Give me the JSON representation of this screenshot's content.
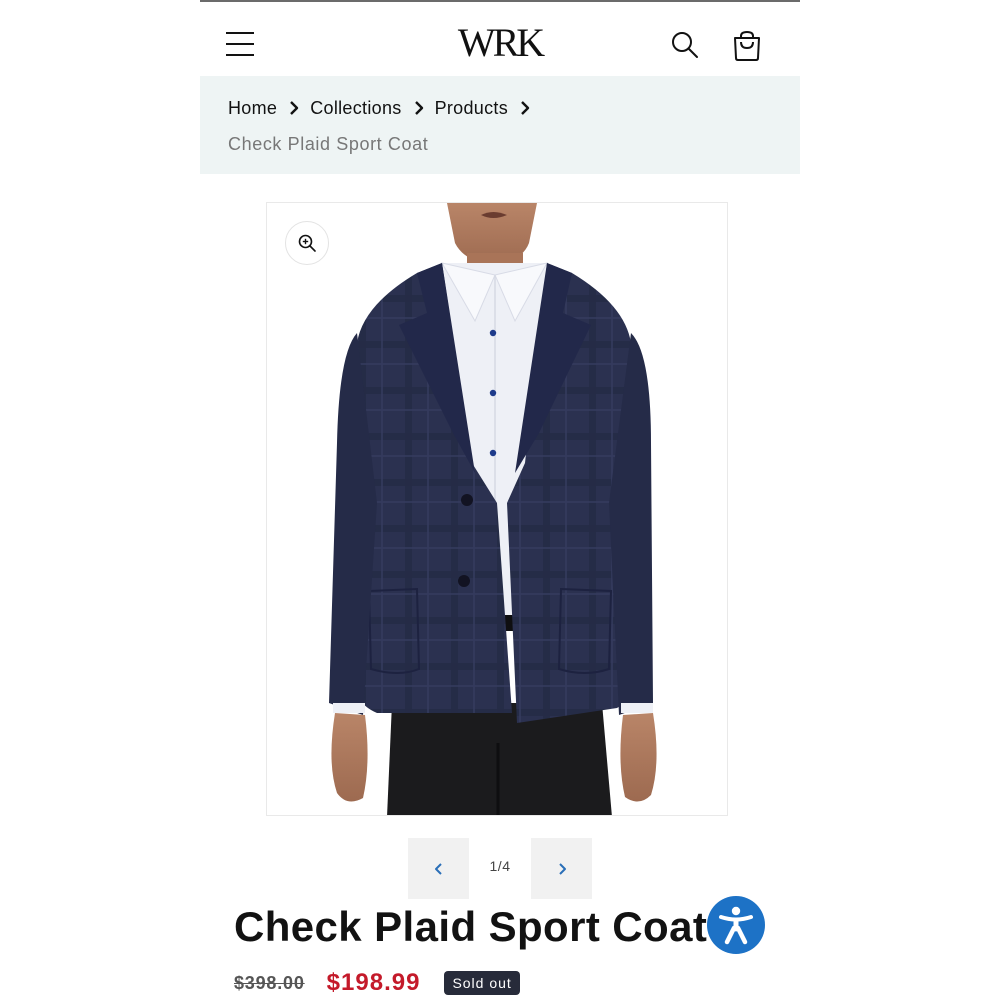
{
  "header": {
    "logo_text": "WRK",
    "icons": {
      "menu": "hamburger-menu-icon",
      "search": "search-icon",
      "cart": "shopping-bag-icon"
    }
  },
  "breadcrumb": {
    "items": [
      "Home",
      "Collections",
      "Products"
    ],
    "current": "Check Plaid Sport Coat"
  },
  "gallery": {
    "zoom_icon": "zoom-in-icon",
    "image_alt": "Model wearing navy check plaid sport coat",
    "counter": "1/4"
  },
  "product": {
    "title": "Check Plaid Sport Coat",
    "price_compare": "$398.00",
    "price_sale": "$198.99",
    "badge": "Sold out"
  },
  "colors": {
    "breadcrumb_bg": "#eef4f4",
    "sale_price": "#c41a2a",
    "badge_bg": "#272b3a",
    "accessibility": "#1d72c6",
    "slider_arrow": "#2a6fb8"
  }
}
